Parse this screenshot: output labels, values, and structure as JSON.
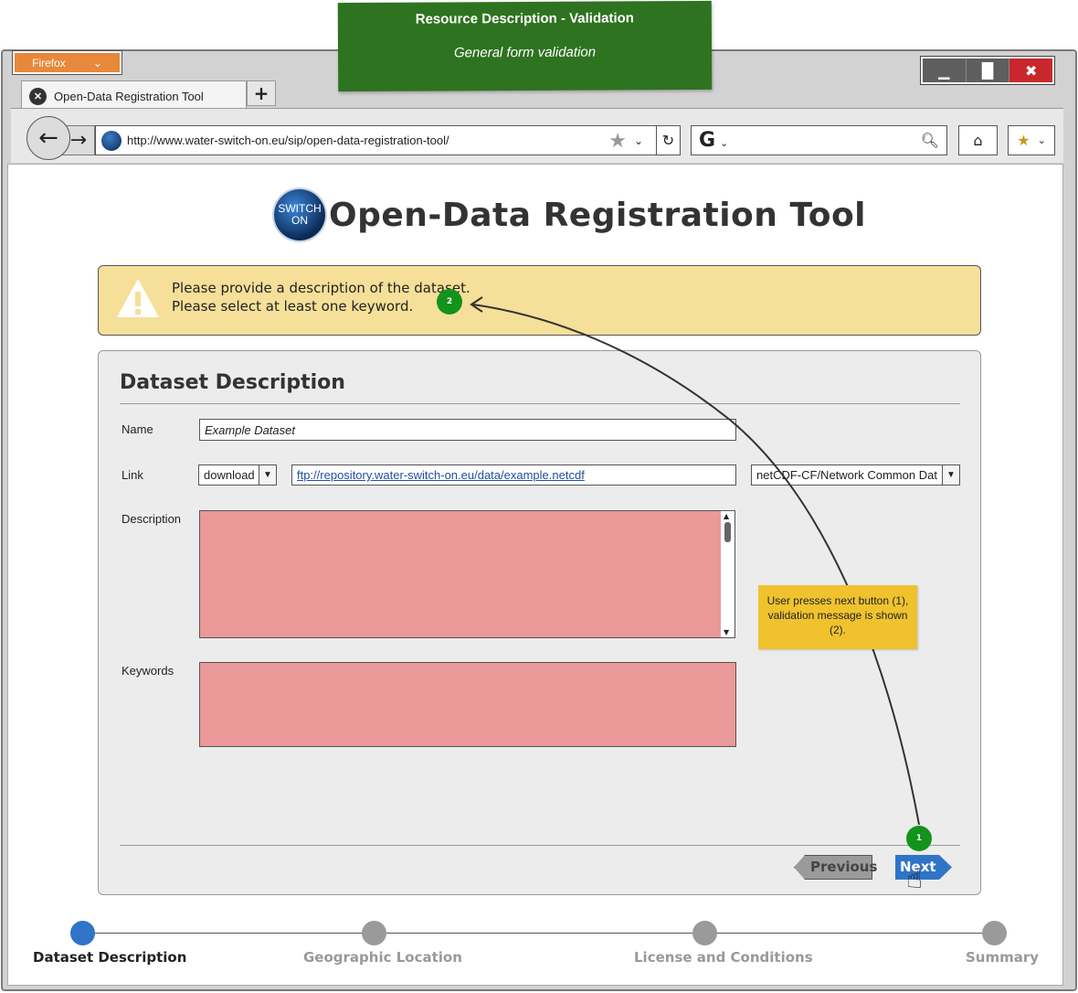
{
  "annotation": {
    "title": "Resource Description  - Validation",
    "subtitle": "General form validation",
    "note": "User presses next button (1), validation message is shown (2).",
    "badge_1": "1",
    "badge_2": "2"
  },
  "browser": {
    "menu_label": "Firefox",
    "tab_title": "Open-Data Registration Tool",
    "url": "http://www.water-switch-on.eu/sip/open-data-registration-tool/",
    "search_engine": "G",
    "window_controls": [
      "minimize",
      "maximize",
      "close"
    ]
  },
  "page": {
    "logo_text": "SWITCH ON",
    "title": "Open-Data Registration Tool"
  },
  "alert": {
    "lines": [
      "Please provide a description of the dataset.",
      "Please select at least one keyword."
    ]
  },
  "form": {
    "section_title": "Dataset Description",
    "name_label": "Name",
    "name_value": "Example Dataset",
    "link_label": "Link",
    "link_type": "download",
    "link_url": "ftp://repository.water-switch-on.eu/data/example.netcdf",
    "format": "netCDF-CF/Network Common Dat",
    "description_label": "Description",
    "keywords_label": "Keywords",
    "previous_label": "Previous",
    "next_label": "Next"
  },
  "stepper": {
    "steps": [
      "Dataset Description",
      "Geographic Location",
      "License and Conditions",
      "Summary"
    ],
    "active_index": 0
  },
  "colors": {
    "accent": "#2f74c7",
    "alert_bg": "#f6df99",
    "invalid_field": "#ea9898",
    "annotation_green": "#2e7320",
    "note_yellow": "#f0c22e"
  }
}
